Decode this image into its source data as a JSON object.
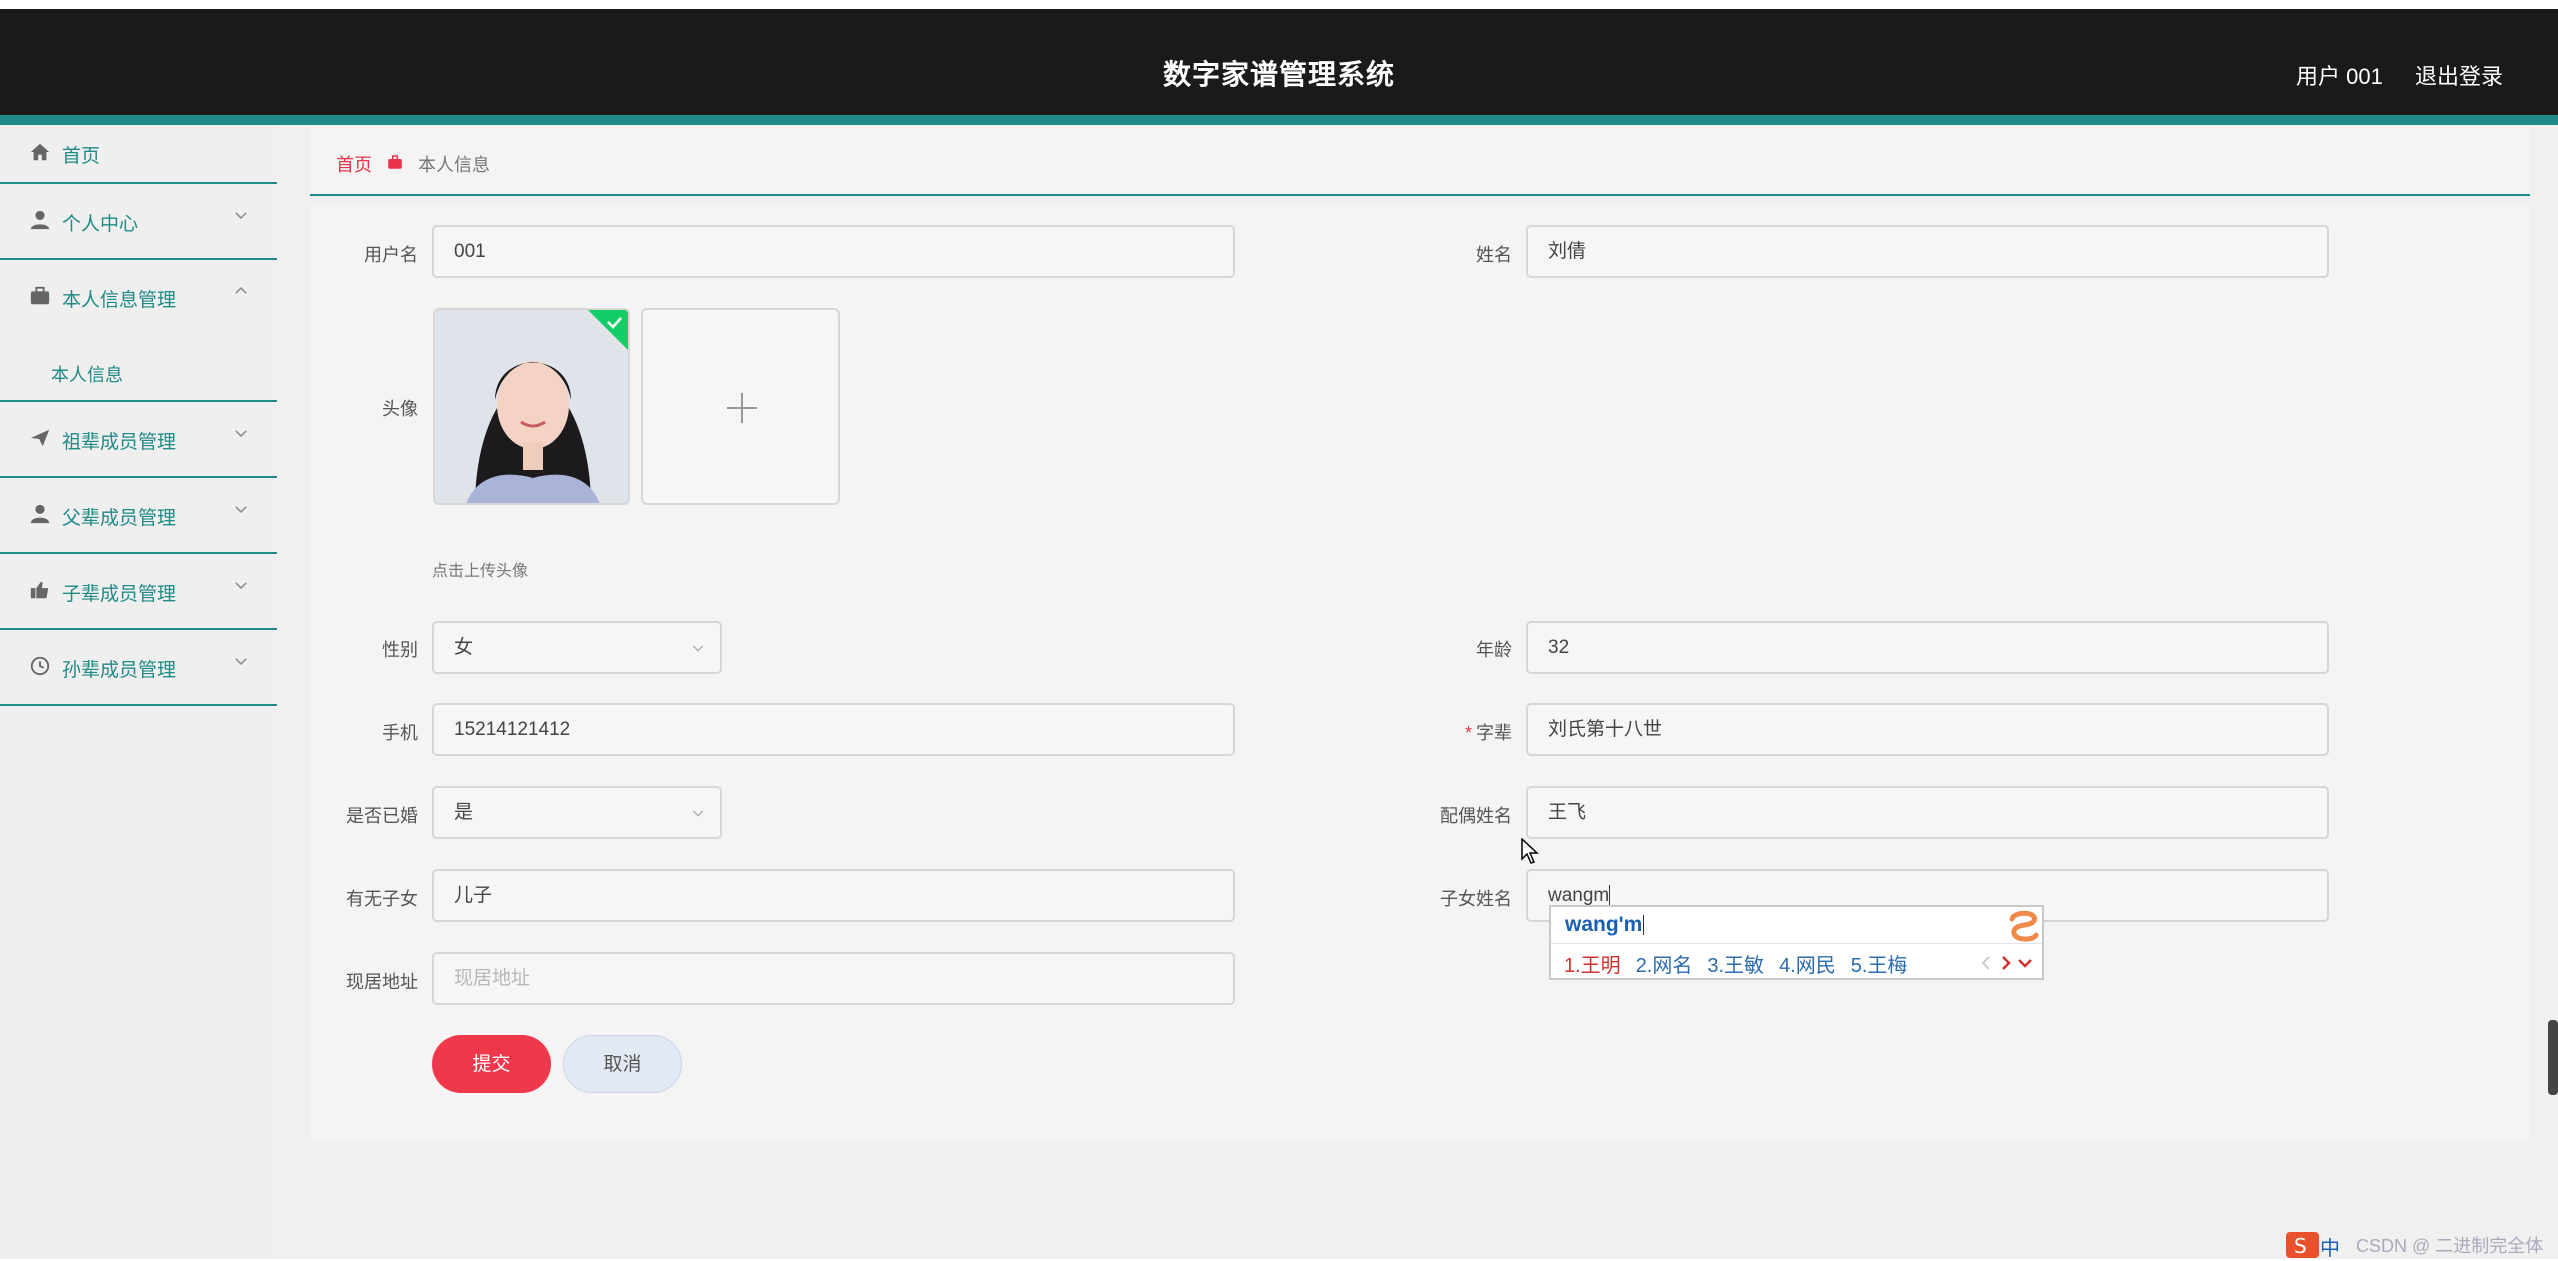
{
  "header": {
    "title": "数字家谱管理系统",
    "user": "用户 001",
    "logout": "退出登录"
  },
  "sidebar": {
    "items": [
      {
        "label": "首页",
        "icon": "home-icon"
      },
      {
        "label": "个人中心",
        "icon": "user-icon"
      },
      {
        "label": "本人信息管理",
        "icon": "briefcase-icon"
      },
      {
        "label": "本人信息",
        "icon": ""
      },
      {
        "label": "祖辈成员管理",
        "icon": "send-icon"
      },
      {
        "label": "父辈成员管理",
        "icon": "person-icon"
      },
      {
        "label": "子辈成员管理",
        "icon": "thumb-icon"
      },
      {
        "label": "孙辈成员管理",
        "icon": "clock-icon"
      }
    ]
  },
  "breadcrumb": {
    "home": "首页",
    "current": "本人信息"
  },
  "form": {
    "username": {
      "label": "用户名",
      "value": "001"
    },
    "name": {
      "label": "姓名",
      "value": "刘倩"
    },
    "avatar": {
      "label": "头像",
      "hint": "点击上传头像"
    },
    "gender": {
      "label": "性别",
      "value": "女"
    },
    "age": {
      "label": "年龄",
      "value": "32"
    },
    "phone": {
      "label": "手机",
      "value": "15214121412"
    },
    "generation": {
      "label": "字辈",
      "required_mark": "*",
      "value": "刘氏第十八世"
    },
    "married": {
      "label": "是否已婚",
      "value": "是"
    },
    "spouse": {
      "label": "配偶姓名",
      "value": "王飞"
    },
    "children": {
      "label": "有无子女",
      "value": "儿子"
    },
    "child_name": {
      "label": "子女姓名",
      "value": "wangm"
    },
    "address": {
      "label": "现居地址",
      "value": "",
      "placeholder": "现居地址"
    }
  },
  "buttons": {
    "submit": "提交",
    "cancel": "取消"
  },
  "ime": {
    "composition": "wang'm",
    "candidates": [
      "1.王明",
      "2.网名",
      "3.王敏",
      "4.网民",
      "5.王梅"
    ]
  },
  "tray": {
    "lang": "中",
    "watermark": "CSDN @ 二进制完全体"
  },
  "colors": {
    "header_bg": "#1a1a1a",
    "accent_teal": "#1f8a86",
    "primary_red": "#f0384c"
  }
}
